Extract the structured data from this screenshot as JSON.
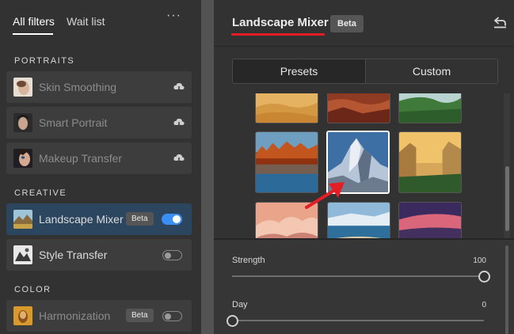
{
  "filters_panel": {
    "tabs": {
      "all_filters": "All filters",
      "wait_list": "Wait list"
    },
    "more_label": "···",
    "sections": {
      "portraits": "PORTRAITS",
      "creative": "CREATIVE",
      "color": "COLOR"
    },
    "items": {
      "skin_smoothing": {
        "label": "Skin Smoothing",
        "icon": "cloud-download-icon"
      },
      "smart_portrait": {
        "label": "Smart Portrait",
        "icon": "cloud-download-icon"
      },
      "makeup_transfer": {
        "label": "Makeup Transfer",
        "icon": "cloud-download-icon"
      },
      "landscape_mixer": {
        "label": "Landscape Mixer",
        "badge": "Beta",
        "toggle_on": true
      },
      "style_transfer": {
        "label": "Style Transfer",
        "toggle_on": false
      },
      "harmonization": {
        "label": "Harmonization",
        "badge": "Beta",
        "toggle_on": false
      }
    }
  },
  "mixer_panel": {
    "title": "Landscape Mixer",
    "badge": "Beta",
    "reset_icon": "undo-icon",
    "segments": {
      "presets": "Presets",
      "custom": "Custom"
    },
    "active_segment": "Presets",
    "presets": [
      "desert",
      "red-canyon",
      "green-valley",
      "autumn-lake",
      "snowy-mountain",
      "yosemite-valley",
      "pink-clouds",
      "coastal-beach",
      "purple-sunset"
    ],
    "selected_preset": "snowy-mountain",
    "sliders": {
      "strength": {
        "label": "Strength",
        "value": "100",
        "fraction": 1.0
      },
      "day": {
        "label": "Day",
        "value": "0",
        "fraction": 0.0
      }
    }
  },
  "colors": {
    "accent_blue": "#3a8ef4",
    "highlight_red": "#e51e25",
    "panel_bg": "#323232",
    "active_item_bg": "#2c4660"
  }
}
